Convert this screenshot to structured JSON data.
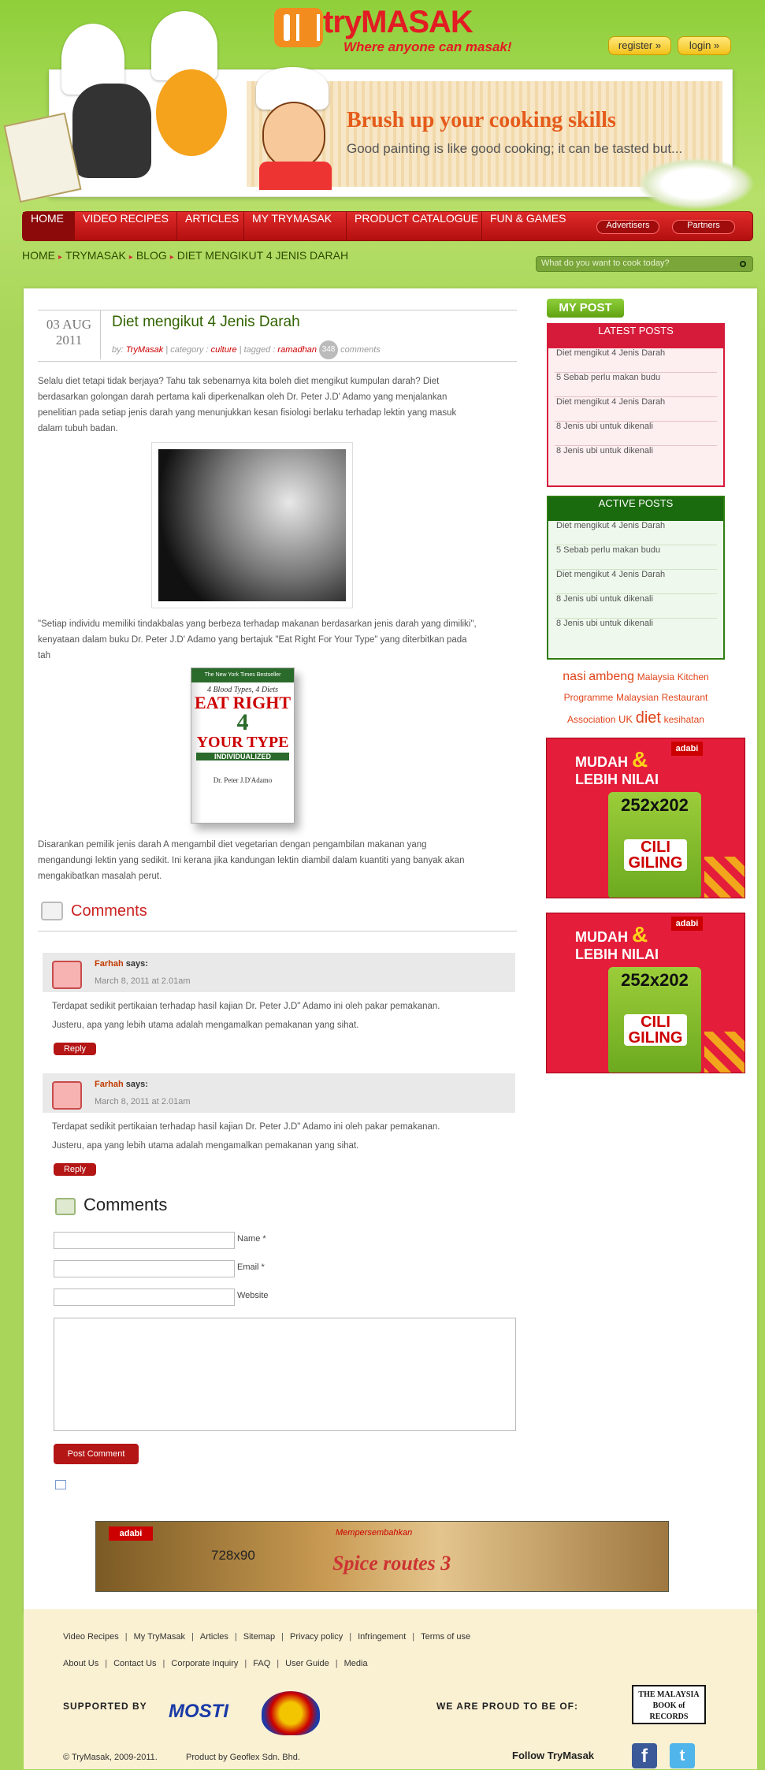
{
  "brand": {
    "name": "tryMASAK",
    "tagline": "Where anyone can masak!",
    "register": "register »",
    "login": "login »"
  },
  "banner": {
    "headline": "Brush up your cooking skills",
    "subline": "Good painting is like good cooking; it can be tasted but..."
  },
  "nav": {
    "items": [
      "HOME",
      "VIDEO RECIPES",
      "ARTICLES",
      "MY TRYMASAK",
      "PRODUCT CATALOGUE",
      "FUN & GAMES"
    ],
    "advertisers": "Advertisers",
    "partners": "Partners"
  },
  "breadcrumb": [
    "HOME",
    "TRYMASAK",
    "BLOG",
    "DIET MENGIKUT 4 JENIS DARAH"
  ],
  "search": {
    "placeholder": "What do you want to cook today?"
  },
  "post": {
    "date_day": "03 AUG",
    "date_year": "2011",
    "title": "Diet mengikut 4 Jenis Darah",
    "by_label": "by:",
    "author": "TryMasak",
    "category_label": "category :",
    "category": "culture",
    "tagged_label": "tagged :",
    "tag": "ramadhan",
    "comment_count": "348",
    "comments_label": "comments",
    "para1": "Selalu diet tetapi tidak berjaya? Tahu tak sebenarnya kita boleh diet mengikut kumpulan darah? Diet berdasarkan golongan darah pertama kali diperkenalkan oleh Dr. Peter J.D' Adamo yang menjalankan penelitian pada setiap jenis darah yang menunjukkan kesan fisiologi berlaku terhadap lektin yang masuk dalam tubuh badan.",
    "para2": "\"Setiap individu memiliki tindakbalas yang berbeza terhadap makanan berdasarkan jenis darah yang dimiliki\", kenyataan dalam buku Dr. Peter J.D' Adamo yang bertajuk \"Eat Right For Your Type\" yang diterbitkan pada tah",
    "para3": "Disarankan pemilik jenis darah A mengambil diet vegetarian dengan pengambilan makanan yang mengandungi lektin yang sedikit. Ini kerana jika kandungan lektin diambil dalam kuantiti yang banyak akan mengakibatkan masalah perut.",
    "book": {
      "top": "The New York Times Bestseller",
      "line1": "4 Blood Types, 4 Diets",
      "line2": "EAT RIGHT",
      "line3": "4",
      "line4": "YOUR TYPE",
      "line5": "INDIVIDUALIZED",
      "author": "Dr. Peter J.D'Adamo"
    }
  },
  "comments": {
    "heading": "Comments",
    "items": [
      {
        "author": "Farhah",
        "says": "says:",
        "date": "March 8, 2011 at 2.01am",
        "line1": "Terdapat sedikit pertikaian terhadap hasil kajian Dr. Peter J.D\" Adamo ini oleh pakar pemakanan.",
        "line2": "Justeru, apa yang lebih utama adalah mengamalkan pemakanan yang sihat.",
        "reply": "Reply"
      },
      {
        "author": "Farhah",
        "says": "says:",
        "date": "March 8, 2011 at 2.01am",
        "line1": "Terdapat sedikit pertikaian terhadap hasil kajian Dr. Peter J.D\" Adamo ini oleh pakar pemakanan.",
        "line2": "Justeru, apa yang lebih utama adalah mengamalkan pemakanan yang sihat.",
        "reply": "Reply"
      }
    ]
  },
  "form": {
    "heading": "Comments",
    "name_label": "Name *",
    "email_label": "Email *",
    "website_label": "Website",
    "submit": "Post Comment"
  },
  "sidebar": {
    "mypost": "MY POST",
    "latest_title": "LATEST POSTS",
    "latest": [
      "Diet mengikut 4 Jenis Darah",
      "5 Sebab perlu makan budu",
      "Diet mengikut 4 Jenis Darah",
      "8 Jenis ubi untuk dikenali",
      "8 Jenis ubi untuk dikenali"
    ],
    "active_title": "ACTIVE POSTS",
    "active": [
      "Diet mengikut 4 Jenis Darah",
      "5 Sebab perlu makan budu",
      "Diet mengikut 4 Jenis Darah",
      "8 Jenis ubi untuk dikenali",
      "8 Jenis ubi untuk dikenali"
    ],
    "tags": [
      "nasi",
      "ambeng",
      "Malaysia",
      "Kitchen",
      "Programme",
      "Malaysian",
      "Restaurant",
      "Association",
      "UK",
      "diet",
      "kesihatan"
    ],
    "ad": {
      "brand": "adabi",
      "line1": "MUDAH",
      "amp": "&",
      "line2": "LEBIH NILAI",
      "size": "252x202",
      "product": "CILI GILING"
    }
  },
  "bottom_ad": {
    "brand": "adabi",
    "size": "728x90",
    "tagline": "Mempersembahkan",
    "product": "Spice routes 3"
  },
  "footer": {
    "links1": [
      "Video Recipes",
      "My TryMasak",
      "Articles",
      "Sitemap",
      "Privacy policy",
      "Infringement",
      "Terms of use"
    ],
    "links2": [
      "About Us",
      "Contact Us",
      "Corporate Inquiry",
      "FAQ",
      "User Guide",
      "Media"
    ],
    "supported_by": "SUPPORTED BY",
    "mosti": "MOSTI",
    "proud": "WE ARE PROUD TO BE OF:",
    "record": "THE MALAYSIA BOOK of RECORDS",
    "copyright": "© TryMasak, 2009-2011.",
    "product_by": "Product by Geoflex Sdn. Bhd.",
    "follow": "Follow TryMasak",
    "colors": {
      "nav": "#c01515",
      "accent": "#8fcf3a"
    }
  }
}
